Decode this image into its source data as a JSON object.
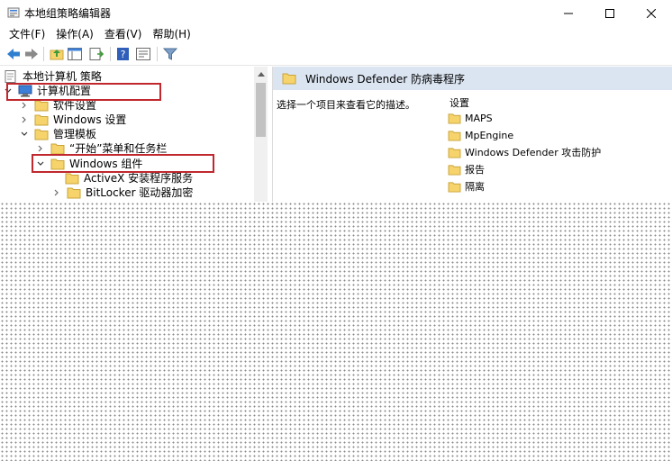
{
  "window": {
    "title": "本地组策略编辑器"
  },
  "menu": [
    "文件(F)",
    "操作(A)",
    "查看(V)",
    "帮助(H)"
  ],
  "tree": {
    "root": "本地计算机 策略",
    "computer_config": "计算机配置",
    "software_settings": "软件设置",
    "windows_settings": "Windows 设置",
    "admin_templates": "管理模板",
    "start_menu": "“开始”菜单和任务栏",
    "windows_components": "Windows 组件",
    "activex": "ActiveX 安装程序服务",
    "bitlocker": "BitLocker 驱动器加密"
  },
  "right": {
    "header": "Windows Defender 防病毒程序",
    "description": "选择一个项目来查看它的描述。",
    "column_header": "设置",
    "items": [
      "MAPS",
      "MpEngine",
      "Windows Defender 攻击防护",
      "报告",
      "隔离"
    ]
  },
  "colors": {
    "highlight_border": "#c0282d",
    "header_bg": "#dbe5f1",
    "folder": "#f6d36b"
  }
}
